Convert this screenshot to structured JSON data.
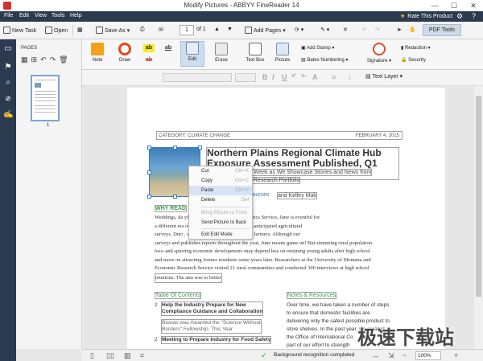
{
  "window": {
    "title": "Modify Pictures - ABBYY FineReader 14",
    "minimize": "—",
    "maximize": "☐",
    "close": "✕"
  },
  "menu": {
    "items": [
      "File",
      "Edit",
      "View",
      "Tools",
      "Help"
    ],
    "rate": "Rate This Product"
  },
  "toolbar": {
    "new_task": "New Task",
    "open": "Open",
    "save_as": "Save As",
    "page_current": "1",
    "page_of": "of 1",
    "add_pages": "Add Pages",
    "pdf_tools": "PDF Tools"
  },
  "pages_panel": {
    "title": "PAGES",
    "page_number": "1"
  },
  "ribbon": {
    "note": "Note",
    "draw": "Draw",
    "hl1": "ab",
    "hl2": "ab",
    "hl3": "ab",
    "edit": "Edit",
    "erase": "Erase",
    "text_box": "Text Box",
    "picture": "Picture",
    "add_stamp": "Add Stamp",
    "bates_numbering": "Bates Numbering",
    "signature": "Signature",
    "redaction": "Redaction",
    "security": "Security"
  },
  "format_bar": {
    "text_layer": "Text Layer"
  },
  "document": {
    "category": "CATEGORY: CLIMATE CHANGE",
    "date": "FEBRUARY 4, 2015",
    "headline": "Northern Plains Regional Climate Hub Exposure Assessment Published, Q1 2015",
    "sub1": "h Week as We Showcase Stories and News from",
    "sub2": "d Research Portfolio",
    "link": "sources",
    "author": "and Kelley Mak",
    "why": "WHY READ",
    "body": [
      "Weddings, da              yful month, but here at the Statistics Service, June is eventful for",
      "a different rea              onduct some of the most widely-anticipated agricultural",
      "surveys. Duri              , we'll survey more than 125,000 farmers. Although our",
      "surveys and publishes reports throughout the year, June means game on! But stemming rural population",
      "loss–and spurring economic development–may depend less on retaining young adults after high school",
      "and more on attracting former residents some years later. Researchers at the University of Montana and",
      "Economic Research Service visited 21 rural communities and conducted 300 interviews at high school",
      "reunions. The aim was to better"
    ],
    "toc_title": "Table Of Contents",
    "toc1_num": "2",
    "toc1_a": "Help the Industry Prepare for New",
    "toc1_b": "Compliance Guidance and Collaboration",
    "toc_note_a": "Biswas was Awarded the \"Science Without",
    "toc_note_b": "Borders\" Fellowship, This Year",
    "toc2_num": "2",
    "toc2": "Meeting to Prepare Industry for Food Safety",
    "notes_title": "Notes & Resources",
    "notes": [
      "Over time, we have taken a number of steps",
      "to ensure that domestic facilities are",
      "delivering only the safest possible product to",
      "store shelves. In the past year, we created",
      "the Office of International Co",
      "part of our effort to strength"
    ]
  },
  "context_menu": {
    "cut": "Cut",
    "cut_key": "Ctrl+X",
    "copy": "Copy",
    "copy_key": "Ctrl+C",
    "paste": "Paste",
    "paste_key": "Ctrl+V",
    "delete": "Delete",
    "delete_key": "Del",
    "bring_front": "Bring Picture to Front",
    "send_back": "Send Picture to Back",
    "exit_edit": "Exit Edit Mode"
  },
  "status": {
    "recognition": "Background recognition completed",
    "zoom": "100%"
  },
  "watermark": "极速下载站"
}
